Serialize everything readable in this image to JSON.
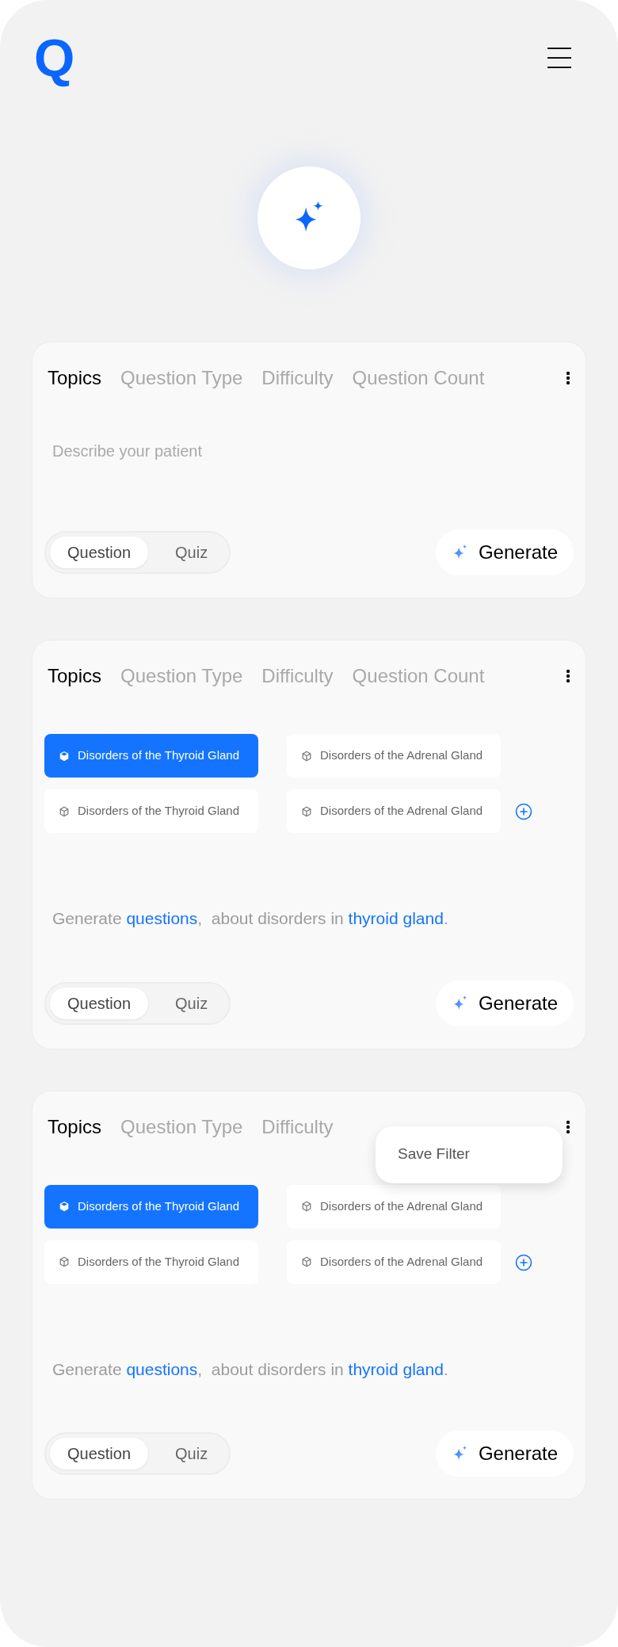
{
  "header": {
    "logo": "Q"
  },
  "cards": [
    {
      "tabs": [
        {
          "label": "Topics",
          "selected": true
        },
        {
          "label": "Question Type",
          "selected": false
        },
        {
          "label": "Difficulty",
          "selected": false
        },
        {
          "label": "Question Count",
          "selected": false
        }
      ],
      "prompt": {
        "placeholder": "Describe your patient"
      },
      "mode": [
        {
          "label": "Question",
          "selected": true
        },
        {
          "label": "Quiz",
          "selected": false
        }
      ],
      "generate": "Generate"
    },
    {
      "tabs": [
        {
          "label": "Topics",
          "selected": true
        },
        {
          "label": "Question Type",
          "selected": false
        },
        {
          "label": "Difficulty",
          "selected": false
        },
        {
          "label": "Question Count",
          "selected": false
        }
      ],
      "chips": [
        {
          "label": "Disorders of the Thyroid Gland",
          "selected": true
        },
        {
          "label": "Disorders of the Adrenal Gland",
          "selected": false
        },
        {
          "label": "Disorders of the Thyroid Gland",
          "selected": false
        },
        {
          "label": "Disorders of the Adrenal Gland",
          "selected": false
        }
      ],
      "sentence": [
        {
          "text": "Generate ",
          "highlight": false
        },
        {
          "text": "questions",
          "highlight": true
        },
        {
          "text": ",  about disorders in ",
          "highlight": false
        },
        {
          "text": "thyroid gland",
          "highlight": true
        },
        {
          "text": ".",
          "highlight": false
        }
      ],
      "mode": [
        {
          "label": "Question",
          "selected": true
        },
        {
          "label": "Quiz",
          "selected": false
        }
      ],
      "generate": "Generate"
    },
    {
      "tabs": [
        {
          "label": "Topics",
          "selected": true
        },
        {
          "label": "Question Type",
          "selected": false
        },
        {
          "label": "Difficulty",
          "selected": false
        }
      ],
      "menu": {
        "items": [
          "Save Filter"
        ]
      },
      "chips": [
        {
          "label": "Disorders of the Thyroid Gland",
          "selected": true
        },
        {
          "label": "Disorders of the Adrenal Gland",
          "selected": false
        },
        {
          "label": "Disorders of the Thyroid Gland",
          "selected": false
        },
        {
          "label": "Disorders of the Adrenal Gland",
          "selected": false
        }
      ],
      "sentence": [
        {
          "text": "Generate ",
          "highlight": false
        },
        {
          "text": "questions",
          "highlight": true
        },
        {
          "text": ",  about disorders in ",
          "highlight": false
        },
        {
          "text": "thyroid gland",
          "highlight": true
        },
        {
          "text": ".",
          "highlight": false
        }
      ],
      "mode": [
        {
          "label": "Question",
          "selected": true
        },
        {
          "label": "Quiz",
          "selected": false
        }
      ],
      "generate": "Generate"
    }
  ]
}
